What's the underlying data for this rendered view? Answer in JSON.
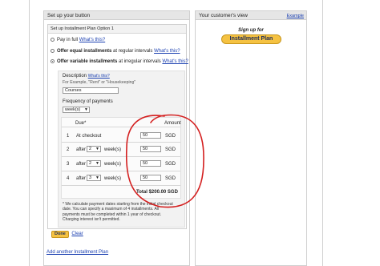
{
  "left_panel": {
    "title": "Set up your button",
    "plan_box_title": "Set up Installment Plan Option 1",
    "options": [
      {
        "text": "Pay in full",
        "link": "What's this?",
        "selected": false
      },
      {
        "text_bold": "Offer equal installments",
        "text": "at regular intervals",
        "link": "What's this?",
        "selected": false
      },
      {
        "text_bold": "Offer variable installments",
        "text": "at irregular intervals",
        "link": "What's this?",
        "selected": true
      }
    ],
    "description_label": "Description",
    "description_link": "What's this?",
    "description_hint": "For Example, \"Rent\" or \"Housekeeping\"",
    "description_value": "Courses",
    "frequency_label": "Frequency of payments",
    "frequency_value": "week(s)",
    "table": {
      "col_due": "Due*",
      "col_amount": "Amount",
      "rows": [
        {
          "num": "1",
          "when": "At checkout",
          "after": "",
          "count": "",
          "unit": "",
          "amount": "50",
          "currency": "SGD"
        },
        {
          "num": "2",
          "when": "",
          "after": "after",
          "count": "2",
          "unit": "week(s)",
          "amount": "50",
          "currency": "SGD"
        },
        {
          "num": "3",
          "when": "",
          "after": "after",
          "count": "2",
          "unit": "week(s)",
          "amount": "50",
          "currency": "SGD"
        },
        {
          "num": "4",
          "when": "",
          "after": "after",
          "count": "3",
          "unit": "week(s)",
          "amount": "50",
          "currency": "SGD"
        }
      ],
      "total_label": "Total",
      "total_value": "$200.00 SGD"
    },
    "note": "* We calculate payment dates starting from the initial checkout date. You can specify a maximum of 4 installments. All payments must be completed within 1 year of checkout. Charging interest isn't permitted.",
    "done_label": "Done",
    "clear_label": "Clear",
    "add_plan_link": "Add another Installment Plan"
  },
  "right_panel": {
    "title": "Your customer's view",
    "example_link": "Example",
    "signup_text": "Sign up for",
    "button_label": "Installment Plan"
  },
  "colors": {
    "annotation_red": "#d42020",
    "button_yellow": "#f5c242"
  }
}
